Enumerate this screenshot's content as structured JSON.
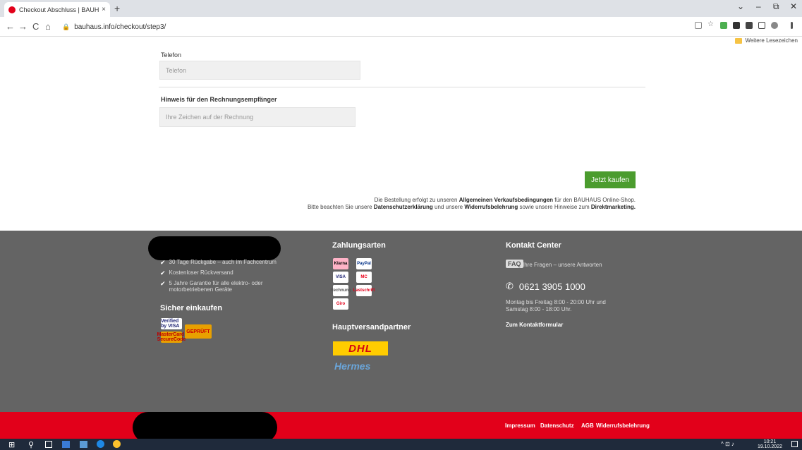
{
  "browser": {
    "tab_title": "Checkout Abschluss | BAUHAUS",
    "tab_close": "×",
    "new_tab": "+",
    "url": "bauhaus.info/checkout/step3/",
    "bookmark_folder": "Weitere Lesezeichen",
    "win_minimize": "–",
    "win_restore": "⧉",
    "win_close": "✕",
    "win_chevron": "⌄",
    "nav_back": "←",
    "nav_forward": "→",
    "nav_reload": "C",
    "nav_home": "⌂",
    "lock": "🔒"
  },
  "form": {
    "telefon_label": "Telefon",
    "telefon_placeholder": "Telefon",
    "hinweis_label": "Hinweis für den Rechnungsempfänger",
    "hinweis_placeholder": "Ihre Zeichen auf der Rechnung",
    "buy_button": "Jetzt kaufen"
  },
  "legal": {
    "line1_a": "Die Bestellung erfolgt zu unseren ",
    "line1_b": "Allgemeinen Verkaufsbedingungen",
    "line1_c": " für den BAUHAUS Online-Shop.",
    "line2_a": "Bitte beachten Sie unsere ",
    "line2_b": "Datenschutzerklärung",
    "line2_c": " und unsere ",
    "line2_d": "Widerrufsbelehrung",
    "line2_e": " sowie unsere Hinweise zum ",
    "line2_f": "Direktmarketing."
  },
  "footer": {
    "benefits": [
      "30 Tage Rückgabe – auch im Fachcentrum",
      "Kostenloser Rückversand",
      "5 Jahre Garantie für alle elektro- oder motorbetriebenen Geräte"
    ],
    "check_mark": "✔",
    "sicher_heading": "Sicher einkaufen",
    "secure_badges": [
      "Verified by VISA",
      "MasterCard SecureCode",
      "GEPRÜFT"
    ],
    "zahlungsarten_heading": "Zahlungsarten",
    "payment_logos": [
      "Klarna",
      "PayPal",
      "VISA",
      "MC",
      "Rechnung",
      "Lastschrift",
      "Giro"
    ],
    "versand_heading": "Hauptversandpartner",
    "dhl": "DHL",
    "hermes": "Hermes",
    "kontakt_heading": "Kontakt Center",
    "faq_badge": "FAQ",
    "faq_text": "Ihre Fragen – unsere Antworten",
    "phone_icon": "✆",
    "phone": "0621 3905 1000",
    "hours_1": "Montag bis Freitag 8:00 - 20:00 Uhr und",
    "hours_2": "Samstag 8:00 - 18:00 Uhr.",
    "kontakt_link": "Zum Kontaktformular",
    "links": [
      "Impressum",
      "Datenschutz",
      "AGB",
      "Widerrufsbelehrung"
    ]
  },
  "taskbar": {
    "start": "⊞",
    "search": "⚲",
    "time": "10:21",
    "date": "19.10.2022",
    "tray": "^ ⊡ ♪"
  },
  "colors": {
    "brand_red": "#e2001a",
    "buy_green": "#4b9c2e",
    "footer_gray": "#646464"
  }
}
